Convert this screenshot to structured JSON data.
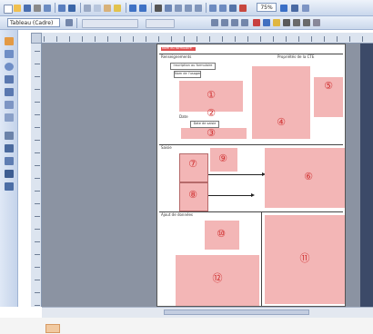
{
  "toolbar": {
    "style_value": "Tableau (Cadre)",
    "zoom": "75%"
  },
  "page": {
    "title": "Nom du formulaire",
    "section1_label": "Renseignements",
    "section1_right_label": "Propriétés de la CTE",
    "field_box_1": "Inscription au formulaire",
    "field_box_2": "Nom de l'usager",
    "small_label": "Date",
    "field_box_3": "Date de saisie",
    "section2_label": "Saisie",
    "section3_label": "Ajout de données"
  },
  "annotations": [
    "①",
    "②",
    "③",
    "④",
    "⑤",
    "⑥",
    "⑦",
    "⑧",
    "⑨",
    "⑩",
    "⑪",
    "⑫"
  ],
  "colors": {
    "placeholder": "#f3b6b6",
    "number": "#d03030",
    "workspace": "#8b93a2"
  }
}
